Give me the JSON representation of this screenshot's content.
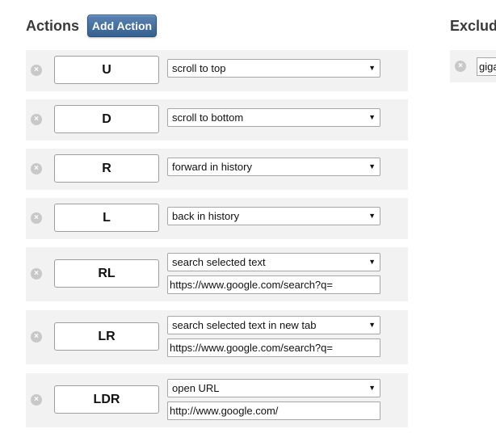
{
  "actions_heading": "Actions",
  "add_action_label": "Add Action",
  "exclusions_heading": "Exclud",
  "remove_glyph": "×",
  "dropdown_arrow": "▼",
  "rows": [
    {
      "gesture": "U",
      "action": "scroll to top"
    },
    {
      "gesture": "D",
      "action": "scroll to bottom"
    },
    {
      "gesture": "R",
      "action": "forward in history"
    },
    {
      "gesture": "L",
      "action": "back in history"
    },
    {
      "gesture": "RL",
      "action": "search selected text",
      "url": "https://www.google.com/search?q="
    },
    {
      "gesture": "LR",
      "action": "search selected text in new tab",
      "url": "https://www.google.com/search?q="
    },
    {
      "gesture": "LDR",
      "action": "open URL",
      "url": "http://www.google.com/"
    }
  ],
  "exclusions": [
    {
      "value": "giga"
    }
  ],
  "colors": {
    "button_bg": "#3f6a9b",
    "row_bg": "#f2f2f2",
    "remove_icon": "#c8c8c8"
  }
}
